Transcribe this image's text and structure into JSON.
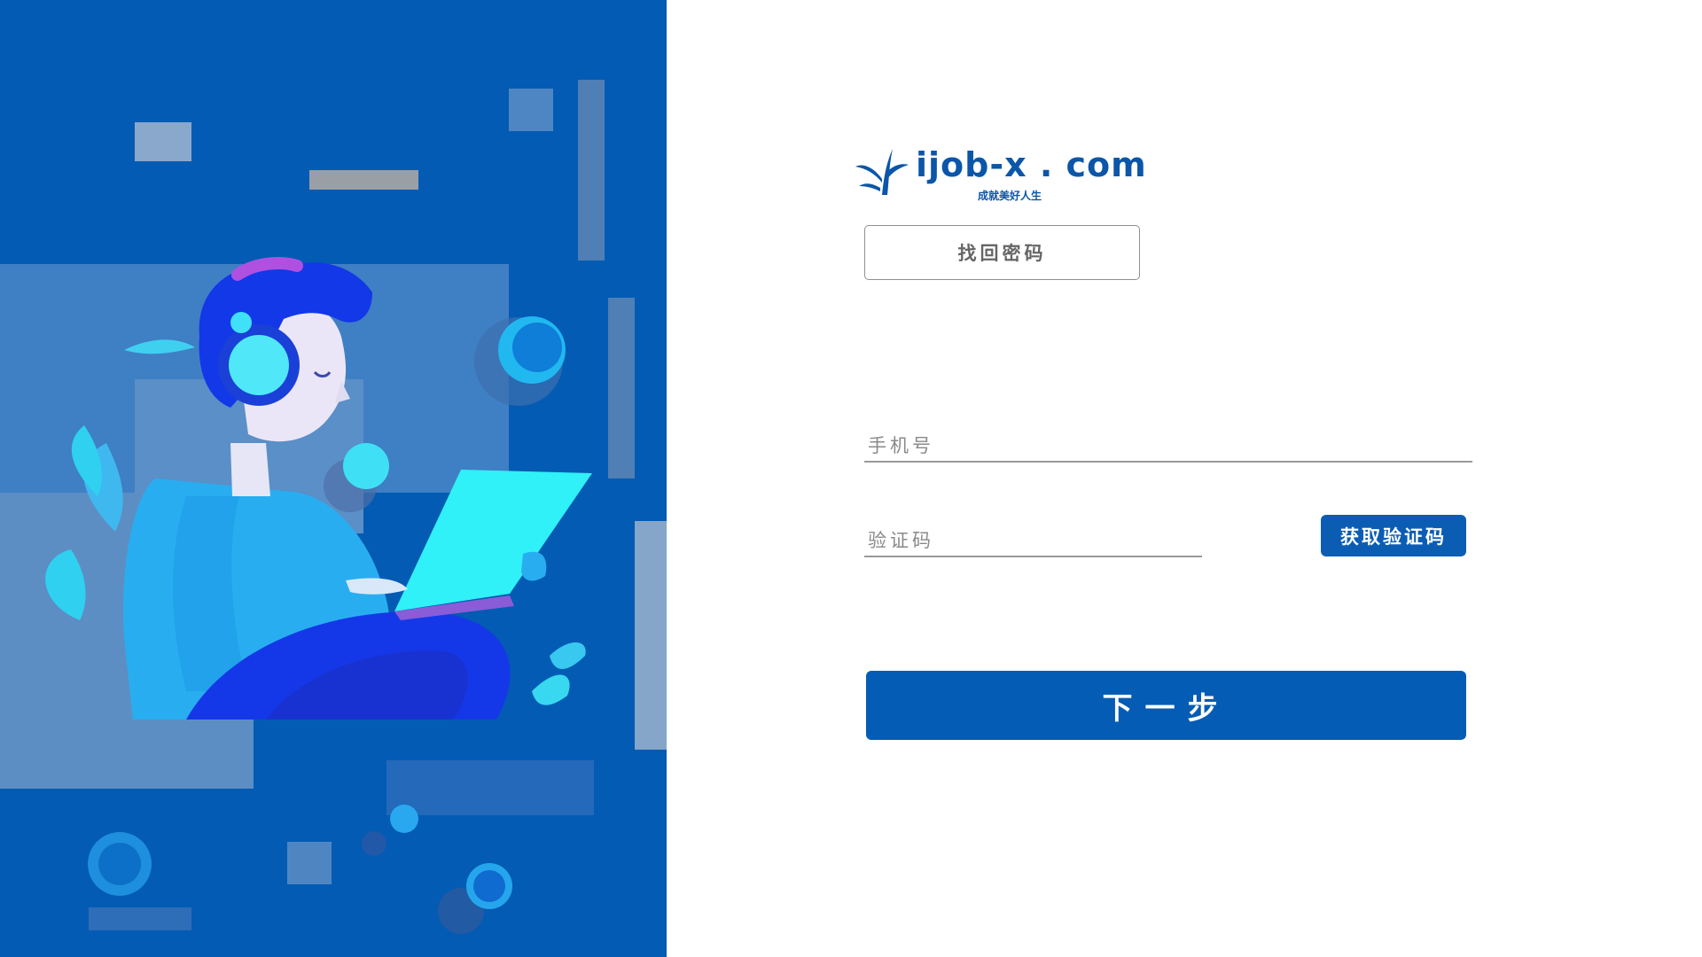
{
  "brand": {
    "logo_text": "ijob-x . com",
    "slogan": "成就美好人生",
    "primary_color": "#045cb4",
    "panel_color": "#035bb3"
  },
  "form": {
    "mode_label": "找回密码",
    "phone": {
      "placeholder": "手机号",
      "value": ""
    },
    "code": {
      "placeholder": "验证码",
      "value": ""
    },
    "get_code_label": "获取验证码",
    "next_label": "下一步"
  },
  "illustration": {
    "subject": "person-with-headphones-and-tablet"
  }
}
